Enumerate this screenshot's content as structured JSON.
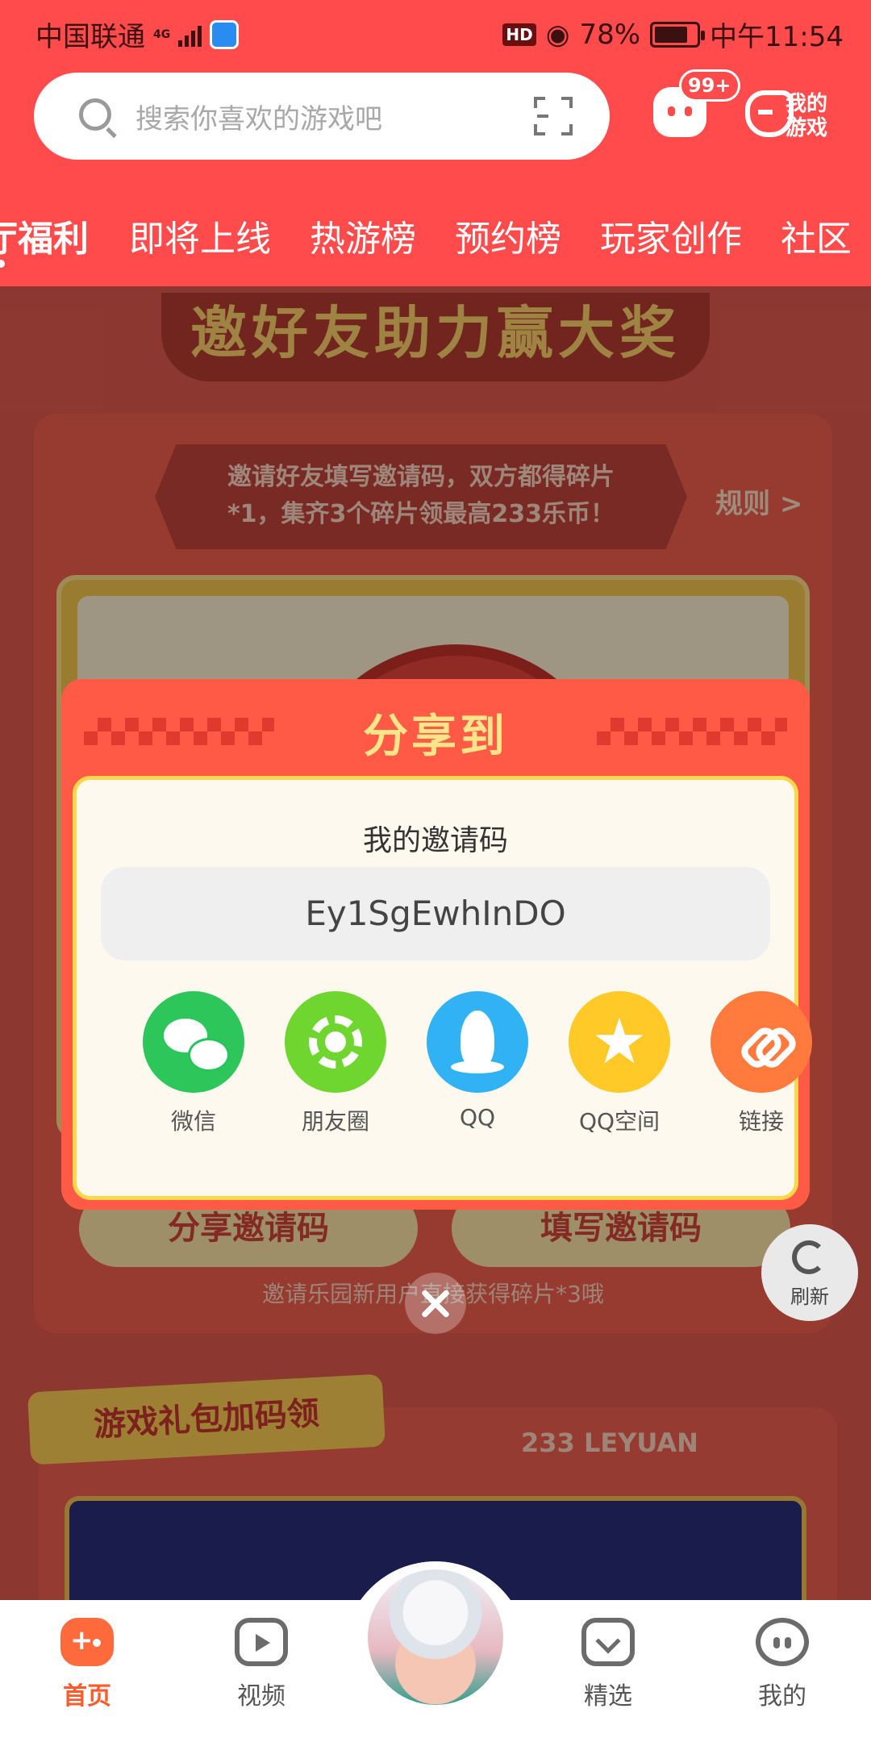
{
  "status_bar": {
    "carrier": "中国联通",
    "network": "4G",
    "battery_percent": "78%",
    "hd": "HD",
    "time": "中午11:54"
  },
  "search": {
    "placeholder": "搜索你喜欢的游戏吧"
  },
  "header": {
    "message_badge": "99+",
    "my_games_line1": "我的",
    "my_games_line2": "游戏"
  },
  "tabs": [
    {
      "label": "厅福利",
      "active": true
    },
    {
      "label": "即将上线",
      "active": false
    },
    {
      "label": "热游榜",
      "active": false
    },
    {
      "label": "预约榜",
      "active": false
    },
    {
      "label": "玩家创作",
      "active": false
    },
    {
      "label": "社区",
      "active": false
    }
  ],
  "page": {
    "banner_title": "邀好友助力赢大奖",
    "invite_desc_line1": "邀请好友填写邀请码，双方都得碎片",
    "invite_desc_line2": "*1，集齐3个碎片领最高233乐币！",
    "rules_link": "规则 >",
    "share_code_button": "分享邀请码",
    "fill_code_button": "填写邀请码",
    "bottom_tip": "邀请乐园新用户直接获得碎片*3哦",
    "gift_section_title": "游戏礼包加码领",
    "brand_text": "233 LEYUAN",
    "refresh_label": "刷新"
  },
  "modal": {
    "title": "分享到",
    "code_label": "我的邀请码",
    "invite_code": "Ey1SgEwhInDO",
    "share_options": [
      {
        "label": "微信",
        "icon": "wechat-icon",
        "color": "#2dc65a"
      },
      {
        "label": "朋友圈",
        "icon": "moments-icon",
        "color": "#6ed62f"
      },
      {
        "label": "QQ",
        "icon": "qq-icon",
        "color": "#30b2f5"
      },
      {
        "label": "QQ空间",
        "icon": "qzone-icon",
        "color": "#ffc928"
      },
      {
        "label": "链接",
        "icon": "link-icon",
        "color": "#ff7a3c"
      }
    ]
  },
  "bottom_nav": [
    {
      "label": "首页",
      "icon": "gamepad-icon",
      "active": true
    },
    {
      "label": "视频",
      "icon": "video-icon",
      "active": false
    },
    {
      "label": "精选",
      "icon": "heart-icon",
      "active": false
    },
    {
      "label": "我的",
      "icon": "profile-icon",
      "active": false
    }
  ],
  "colors": {
    "header_red": "#ff4b4b",
    "modal_red": "#ff5a45",
    "active_nav": "#ff5a2c"
  }
}
